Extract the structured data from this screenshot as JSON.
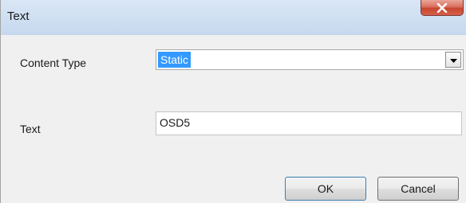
{
  "window": {
    "title": "Text"
  },
  "form": {
    "content_type_label": "Content Type",
    "content_type_value": "Static",
    "text_label": "Text",
    "text_value": "OSD5"
  },
  "buttons": {
    "ok_label": "OK",
    "cancel_label": "Cancel"
  },
  "icons": {
    "close": "close-icon",
    "dropdown": "chevron-down-icon"
  },
  "colors": {
    "selection": "#3399ff",
    "close_button": "#c7452e"
  }
}
